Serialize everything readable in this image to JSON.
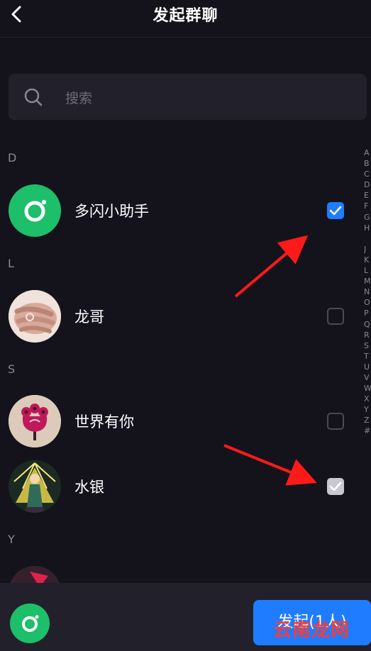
{
  "header": {
    "title": "发起群聊"
  },
  "search": {
    "placeholder": "搜索"
  },
  "sections": {
    "d": "D",
    "l": "L",
    "s": "S",
    "y": "Y"
  },
  "contacts": [
    {
      "name": "多闪小助手",
      "checked": true
    },
    {
      "name": "龙哥",
      "checked": false
    },
    {
      "name": "世界有你",
      "checked": false
    },
    {
      "name": "水银",
      "checked": "disabled"
    }
  ],
  "index_bar": [
    "A",
    "B",
    "C",
    "D",
    "E",
    "F",
    "G",
    "H",
    "",
    "J",
    "K",
    "L",
    "M",
    "N",
    "O",
    "P",
    "Q",
    "R",
    "S",
    "T",
    "U",
    "V",
    "W",
    "X",
    "Y",
    "Z",
    "#"
  ],
  "bottom_bar": {
    "start_button_label": "发起(1人)"
  },
  "watermark": "云南龙网",
  "colors": {
    "background": "#14131c",
    "accent": "#1f7cff",
    "dot_green": "#1dbf6a",
    "annotation_arrow": "#ff1a1a"
  }
}
